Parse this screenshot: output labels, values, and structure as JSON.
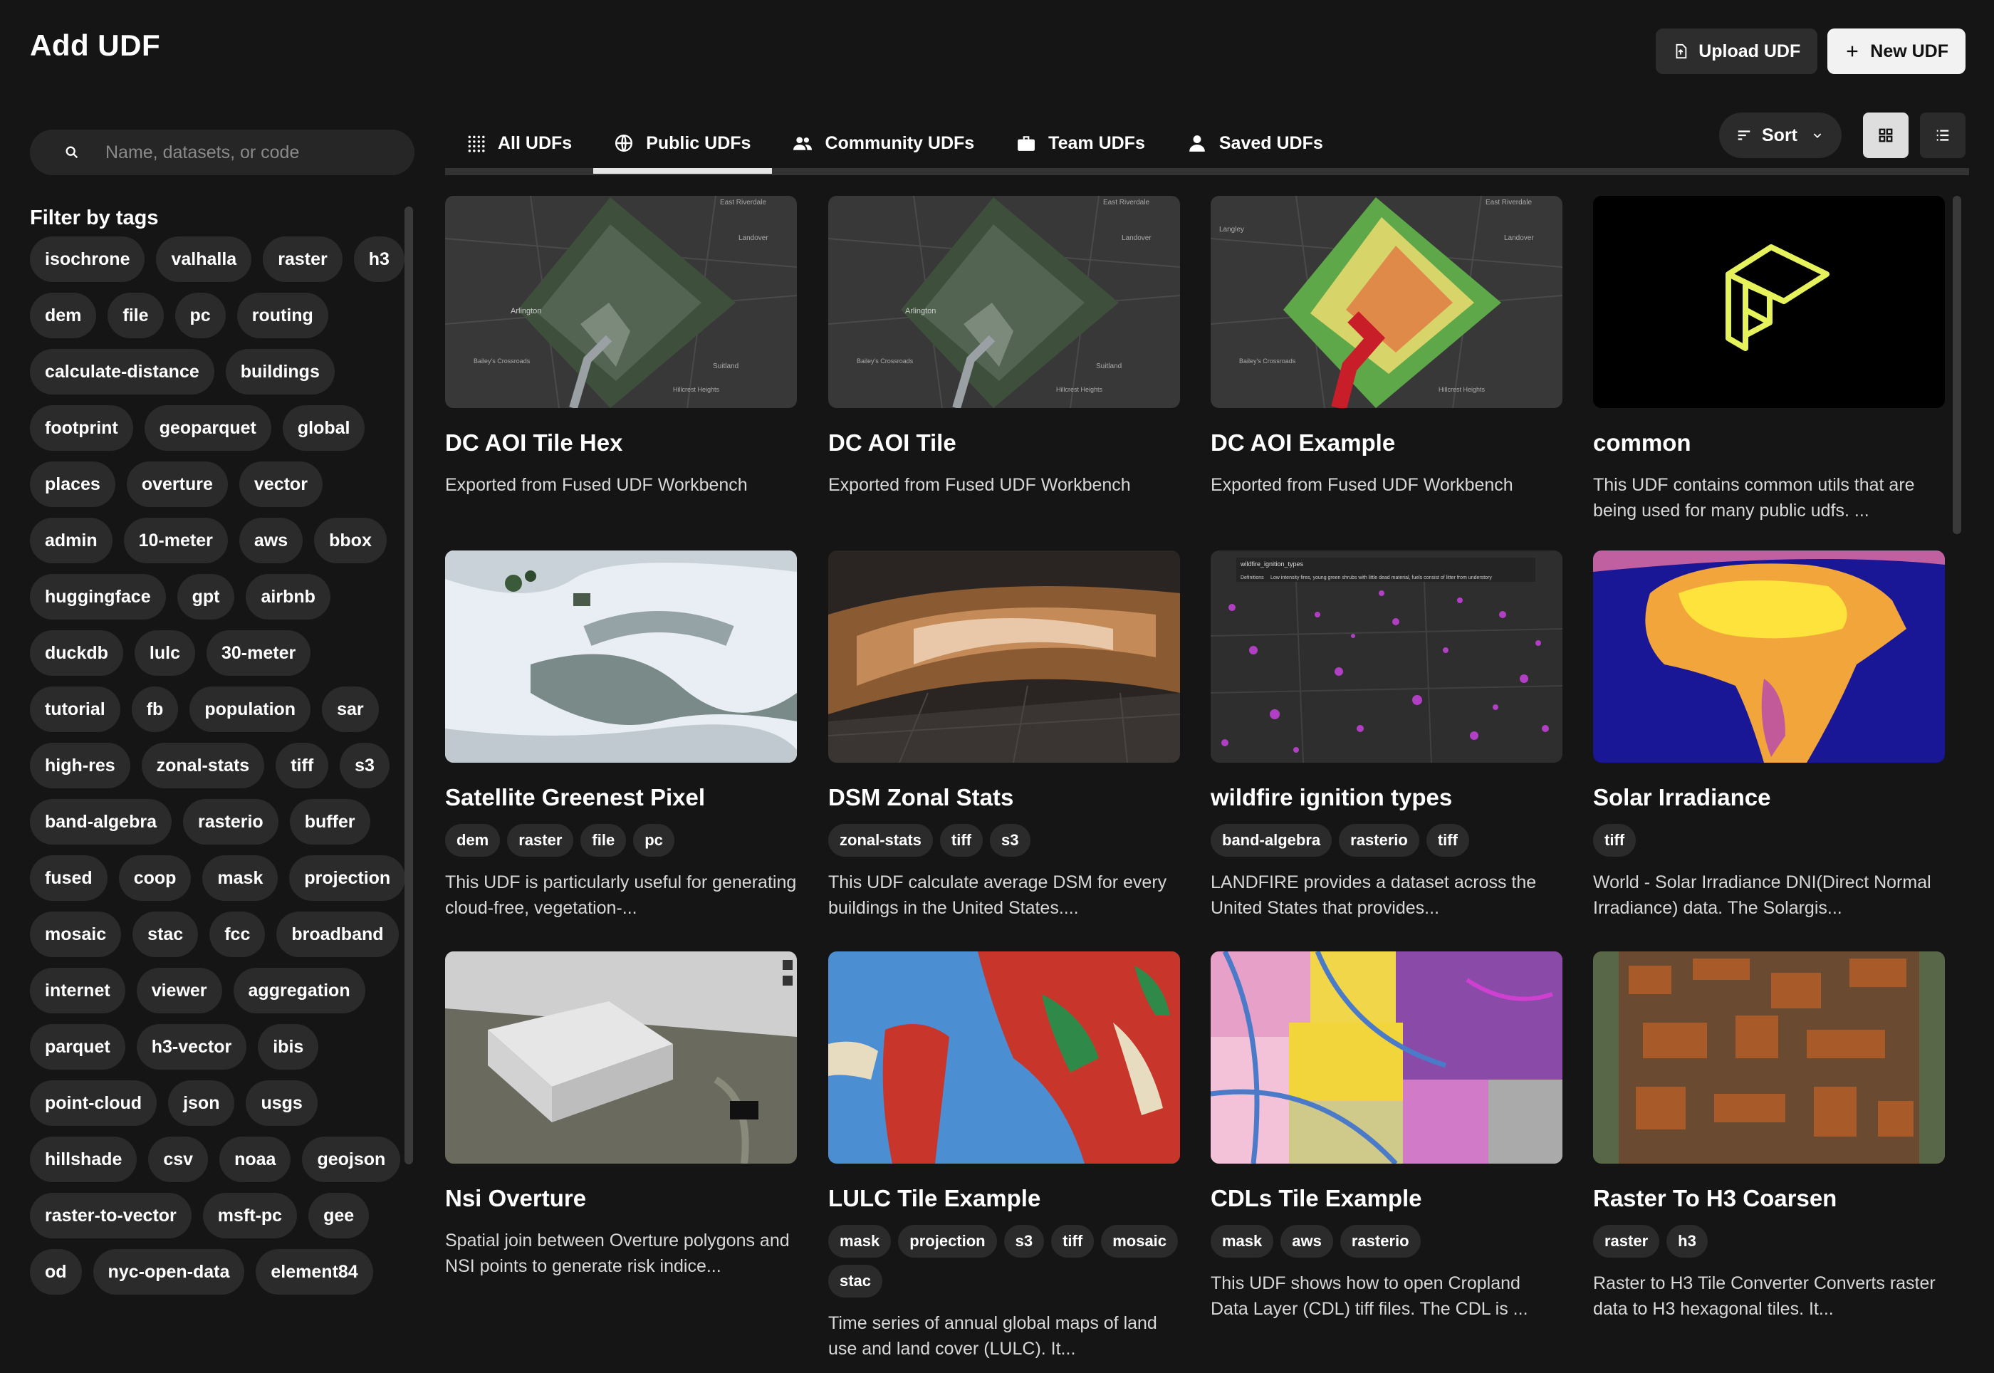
{
  "header": {
    "title": "Add UDF",
    "upload_label": "Upload UDF",
    "new_label": "New UDF"
  },
  "search": {
    "placeholder": "Name, datasets, or code",
    "value": ""
  },
  "filter": {
    "title": "Filter by tags",
    "tags": [
      "isochrone",
      "valhalla",
      "raster",
      "h3",
      "dem",
      "file",
      "pc",
      "routing",
      "calculate-distance",
      "buildings",
      "footprint",
      "geoparquet",
      "global",
      "places",
      "overture",
      "vector",
      "admin",
      "10-meter",
      "aws",
      "bbox",
      "huggingface",
      "gpt",
      "airbnb",
      "duckdb",
      "lulc",
      "30-meter",
      "tutorial",
      "fb",
      "population",
      "sar",
      "high-res",
      "zonal-stats",
      "tiff",
      "s3",
      "band-algebra",
      "rasterio",
      "buffer",
      "fused",
      "coop",
      "mask",
      "projection",
      "mosaic",
      "stac",
      "fcc",
      "broadband",
      "internet",
      "viewer",
      "aggregation",
      "parquet",
      "h3-vector",
      "ibis",
      "point-cloud",
      "json",
      "usgs",
      "hillshade",
      "csv",
      "noaa",
      "geojson",
      "raster-to-vector",
      "msft-pc",
      "gee",
      "od",
      "nyc-open-data",
      "element84"
    ]
  },
  "tabs": [
    {
      "label": "All UDFs",
      "icon": "grid-dots-icon",
      "active": false
    },
    {
      "label": "Public UDFs",
      "icon": "globe-icon",
      "active": true
    },
    {
      "label": "Community UDFs",
      "icon": "people-icon",
      "active": false
    },
    {
      "label": "Team UDFs",
      "icon": "briefcase-icon",
      "active": false
    },
    {
      "label": "Saved UDFs",
      "icon": "person-icon",
      "active": false
    }
  ],
  "controls": {
    "sort_label": "Sort",
    "view": "grid"
  },
  "cards": [
    {
      "title": "DC AOI Tile Hex",
      "tags": [],
      "description": "Exported from Fused UDF Workbench"
    },
    {
      "title": "DC AOI Tile",
      "tags": [],
      "description": "Exported from Fused UDF Workbench"
    },
    {
      "title": "DC AOI Example",
      "tags": [],
      "description": "Exported from Fused UDF Workbench"
    },
    {
      "title": "common",
      "tags": [],
      "description": "This UDF contains common utils that are being used for many public udfs. ..."
    },
    {
      "title": "Satellite Greenest Pixel",
      "tags": [
        "dem",
        "raster",
        "file",
        "pc"
      ],
      "description": "This UDF is particularly useful for generating cloud-free, vegetation-..."
    },
    {
      "title": "DSM Zonal Stats",
      "tags": [
        "zonal-stats",
        "tiff",
        "s3"
      ],
      "description": "This UDF calculate average DSM for every buildings in the United States...."
    },
    {
      "title": "wildfire ignition types",
      "tags": [
        "band-algebra",
        "rasterio",
        "tiff"
      ],
      "description": "LANDFIRE provides a dataset across the United States that provides..."
    },
    {
      "title": "Solar Irradiance",
      "tags": [
        "tiff"
      ],
      "description": "World - Solar Irradiance DNI(Direct Normal Irradiance) data. The Solargis..."
    },
    {
      "title": "Nsi Overture",
      "tags": [],
      "description": "Spatial join between Overture polygons and NSI points to generate risk indice..."
    },
    {
      "title": "LULC Tile Example",
      "tags": [
        "mask",
        "projection",
        "s3",
        "tiff",
        "mosaic",
        "stac"
      ],
      "description": "Time series of annual global maps of land use and land cover (LULC). It..."
    },
    {
      "title": "CDLs Tile Example",
      "tags": [
        "mask",
        "aws",
        "rasterio"
      ],
      "description": "This UDF shows how to open Cropland Data Layer (CDL) tiff files. The CDL is ..."
    },
    {
      "title": "Raster To H3 Coarsen",
      "tags": [
        "raster",
        "h3"
      ],
      "description": "Raster to H3 Tile Converter Converts raster data to H3 hexagonal tiles. It..."
    }
  ],
  "map_labels": [
    "East Riverdale",
    "Landover",
    "Arlington",
    "Bailey's Crossroads",
    "Suitland",
    "Hillcrest Heights",
    "Langley"
  ],
  "wildfire_legend": {
    "title": "wildfire_ignition_types",
    "definition_label": "Definitions",
    "definition": "Low intensity fires, young green shrubs with little dead material, fuels consist of litter from understory"
  }
}
